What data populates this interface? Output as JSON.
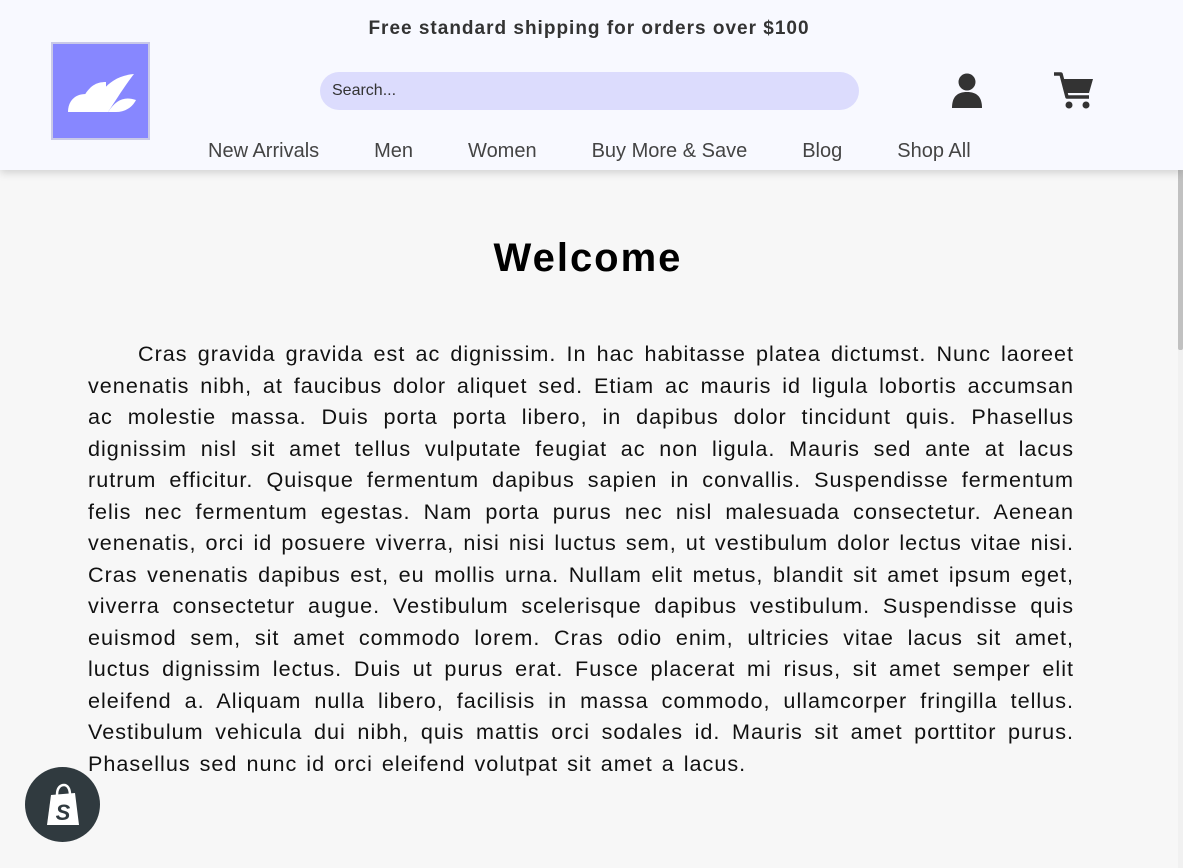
{
  "header": {
    "promo": "Free standard shipping for orders over $100",
    "search_placeholder": "Search...",
    "logo_icon": "leaf-logo-icon",
    "account_icon": "user-icon",
    "cart_icon": "shopping-cart-icon"
  },
  "nav": {
    "items": [
      {
        "label": "New Arrivals"
      },
      {
        "label": "Men"
      },
      {
        "label": "Women"
      },
      {
        "label": "Buy More & Save"
      },
      {
        "label": "Blog"
      },
      {
        "label": "Shop All"
      }
    ]
  },
  "main": {
    "title": "Welcome",
    "body": "Cras gravida gravida est ac dignissim. In hac habitasse platea dictumst. Nunc laoreet venenatis nibh, at faucibus dolor aliquet sed. Etiam ac mauris id ligula lobortis accumsan ac molestie massa. Duis porta porta libero, in dapibus dolor tincidunt quis. Phasellus dignissim nisl sit amet tellus vulputate feugiat ac non ligula. Mauris sed ante at lacus rutrum efficitur. Quisque fermentum dapibus sapien in convallis. Suspendisse fermentum felis nec fermentum egestas. Nam porta purus nec nisl malesuada consectetur. Aenean venenatis, orci id posuere viverra, nisi nisi luctus sem, ut vestibulum dolor lectus vitae nisi. Cras venenatis dapibus est, eu mollis urna. Nullam elit metus, blandit sit amet ipsum eget, viverra consectetur augue. Vestibulum scelerisque dapibus vestibulum. Suspendisse quis euismod sem, sit amet commodo lorem. Cras odio enim, ultricies vitae lacus sit amet, luctus dignissim lectus. Duis ut purus erat. Fusce placerat mi risus, sit amet semper elit eleifend a. Aliquam nulla libero, facilisis in massa commodo, ullamcorper fringilla tellus. Vestibulum vehicula dui nibh, quis mattis orci sodales id. Mauris sit amet porttitor purus. Phasellus sed nunc id orci eleifend volutpat sit amet a lacus."
  },
  "widgets": {
    "shopify_icon": "shopify-bag-icon"
  },
  "colors": {
    "header_bg": "#f8f9ff",
    "logo_bg": "#8787ff",
    "search_bg": "#dcdcfd",
    "page_bg": "#f7f7f7",
    "shopify_badge": "#303a3f"
  }
}
